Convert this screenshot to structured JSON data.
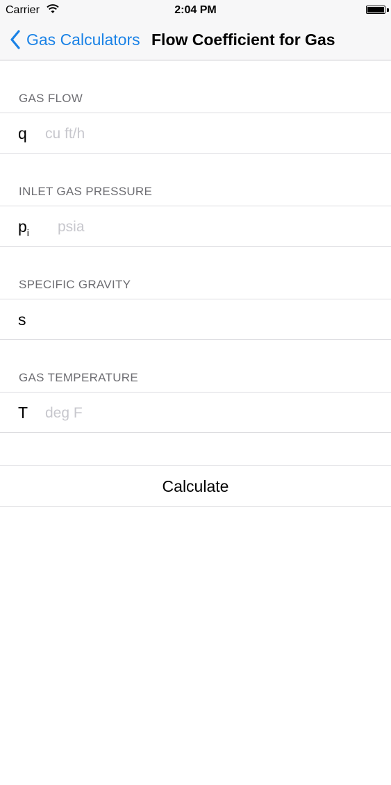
{
  "status_bar": {
    "carrier": "Carrier",
    "time": "2:04 PM",
    "icons": [
      "wifi-icon",
      "battery-icon"
    ]
  },
  "nav": {
    "back_label": "Gas Calculators",
    "title": "Flow Coefficient for Gas",
    "accent_color": "#1a82e6"
  },
  "sections": [
    {
      "header": "GAS FLOW",
      "label": "q",
      "subscript": "",
      "value": "",
      "placeholder": "cu ft/h"
    },
    {
      "header": "INLET GAS PRESSURE",
      "label": "p",
      "subscript": "i",
      "value": "",
      "placeholder": "psia"
    },
    {
      "header": "SPECIFIC GRAVITY",
      "label": "s",
      "subscript": "",
      "value": "",
      "placeholder": ""
    },
    {
      "header": "GAS TEMPERATURE",
      "label": "T",
      "subscript": "",
      "value": "",
      "placeholder": "deg F"
    }
  ],
  "calculate_label": "Calculate"
}
